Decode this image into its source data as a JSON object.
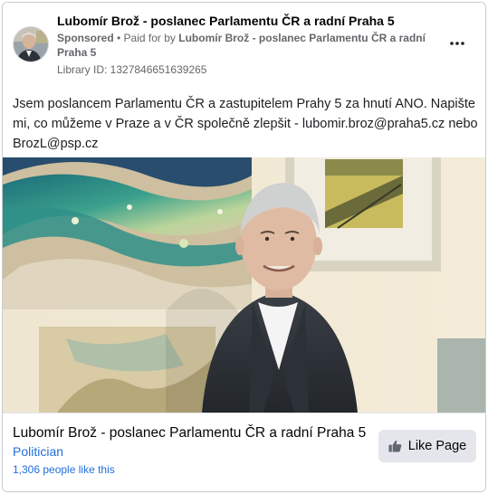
{
  "header": {
    "page_name": "Lubomír Brož - poslanec Parlamentu ČR a radní Praha 5",
    "sponsored": "Sponsored",
    "separator": " • ",
    "paid_for_prefix": "Paid for by ",
    "paid_for_by": "Lubomír Brož - poslanec Parlamentu ČR a radní Praha 5",
    "library_id": "Library ID: 1327846651639265",
    "more_icon": "more-horizontal-icon"
  },
  "body": {
    "text": "Jsem poslancem Parlamentu ČR a zastupitelem Prahy 5 za hnutí ANO. Napište mi, co můžeme v Praze a v ČR společně zlepšit - lubomir.broz@praha5.cz nebo BrozL@psp.cz"
  },
  "footer": {
    "title": "Lubomír Brož - poslanec Parlamentu ČR a radní Praha 5",
    "category": "Politician",
    "likes": "1,306 people like this",
    "like_button": "Like Page",
    "like_icon": "thumbs-up-icon"
  },
  "colors": {
    "link_blue": "#216fdb",
    "meta_gray": "#65676b",
    "button_gray": "#e4e6eb"
  }
}
